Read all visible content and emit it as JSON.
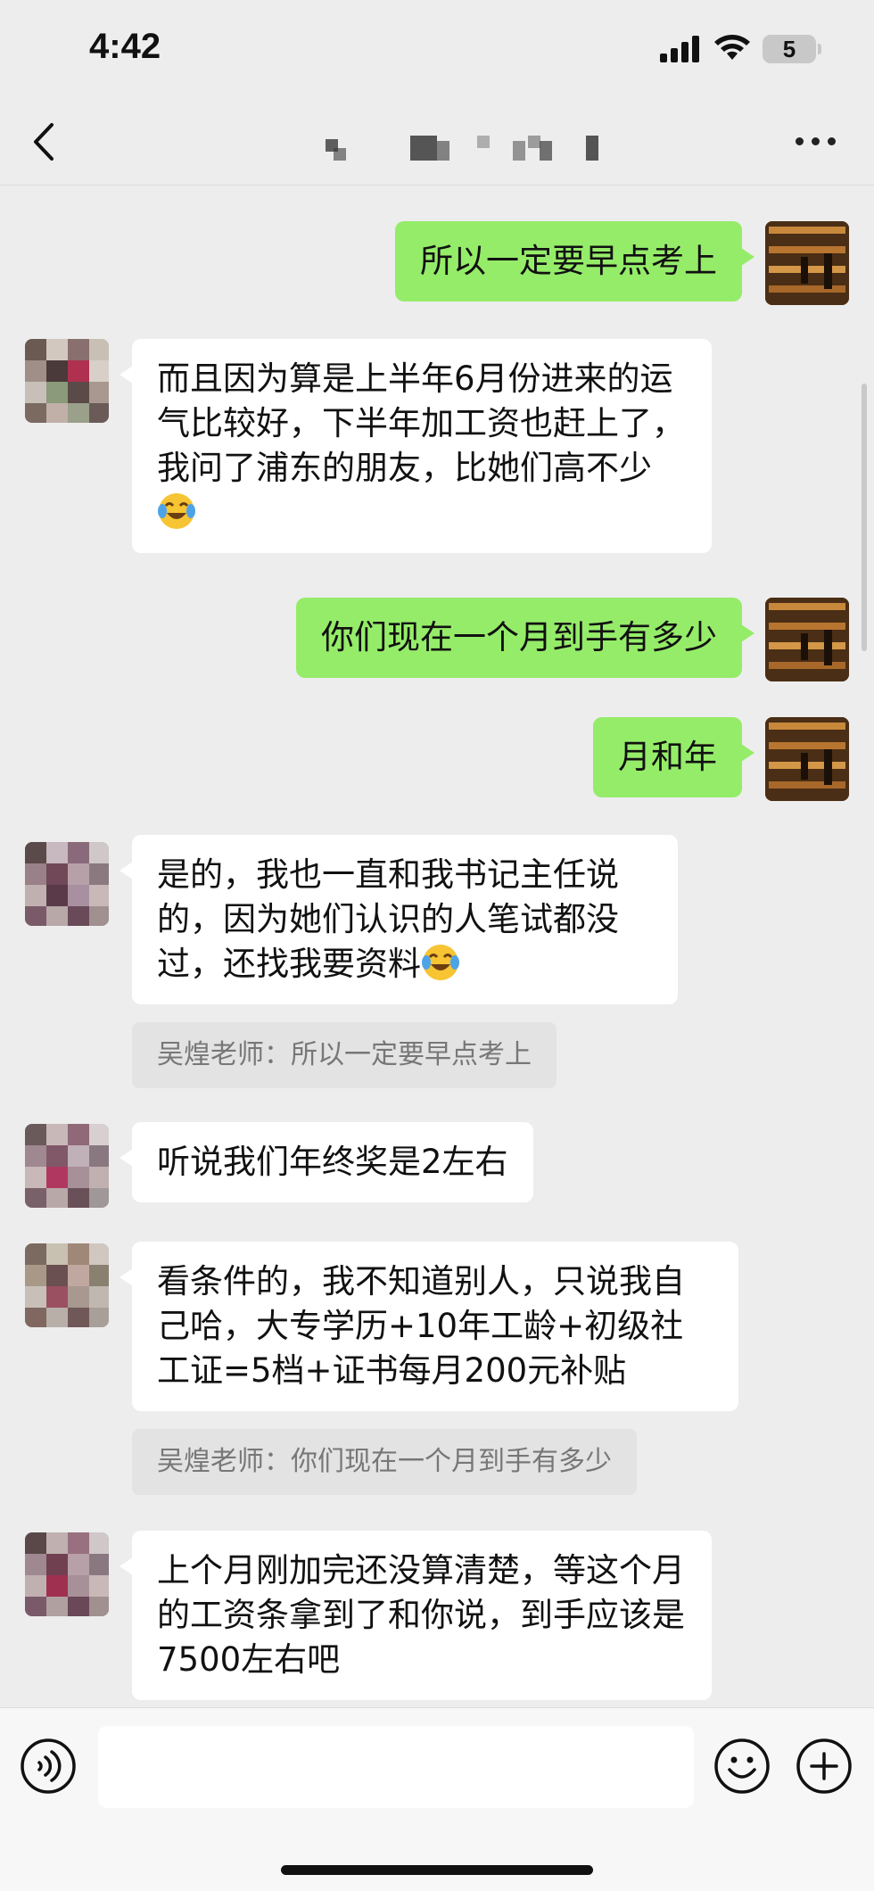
{
  "status_bar": {
    "time": "4:42",
    "battery": "5"
  },
  "nav": {
    "title_blurred": true
  },
  "messages": [
    {
      "side": "me",
      "text": "所以一定要早点考上"
    },
    {
      "side": "other",
      "text": "而且因为算是上半年6月份进来的运气比较好，下半年加工资也赶上了，我问了浦东的朋友，比她们高不少",
      "emoji": "face-with-tears-of-joy"
    },
    {
      "side": "me",
      "text": "你们现在一个月到手有多少"
    },
    {
      "side": "me",
      "text": "月和年"
    },
    {
      "side": "other",
      "text": "是的，我也一直和我书记主任说的，因为她们认识的人笔试都没过，还找我要资料",
      "emoji": "face-with-tears-of-joy",
      "quote": "吴煌老师：所以一定要早点考上"
    },
    {
      "side": "other",
      "text": "听说我们年终奖是2左右"
    },
    {
      "side": "other",
      "text": "看条件的，我不知道别人，只说我自己哈，大专学历+10年工龄+初级社工证=5档+证书每月200元补贴",
      "quote": "吴煌老师：你们现在一个月到手有多少"
    },
    {
      "side": "other",
      "text": "上个月刚加完还没算清楚，等这个月的工资条拿到了和你说，到手应该是7500左右吧"
    }
  ],
  "colors": {
    "bubble_me": "#95ec69",
    "bubble_other": "#ffffff",
    "background": "#ededed"
  },
  "input_bar": {
    "placeholder": ""
  }
}
